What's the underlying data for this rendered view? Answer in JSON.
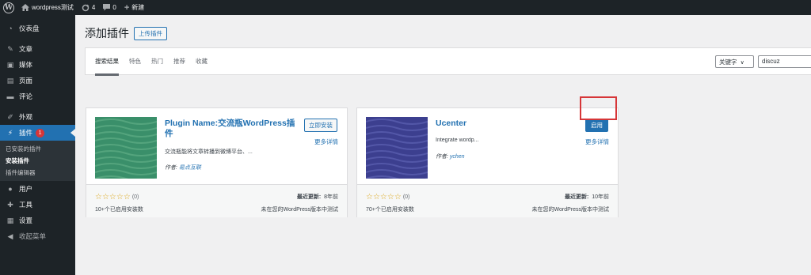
{
  "adminbar": {
    "site_name": "wordpress测试",
    "updates_count": "4",
    "comments_count": "0",
    "new_label": "新建"
  },
  "sidebar": {
    "items": [
      {
        "label": "仪表盘",
        "icon": "dashboard-icon"
      },
      {
        "label": "文章",
        "icon": "pin-icon"
      },
      {
        "label": "媒体",
        "icon": "media-icon"
      },
      {
        "label": "页面",
        "icon": "page-icon"
      },
      {
        "label": "评论",
        "icon": "comment-icon"
      },
      {
        "label": "外观",
        "icon": "brush-icon"
      },
      {
        "label": "插件",
        "icon": "plugin-icon",
        "badge": "1"
      },
      {
        "label": "用户",
        "icon": "user-icon"
      },
      {
        "label": "工具",
        "icon": "wrench-icon"
      },
      {
        "label": "设置",
        "icon": "settings-icon"
      },
      {
        "label": "收起菜单",
        "icon": "collapse-icon"
      }
    ],
    "submenu": [
      "已安装的插件",
      "安装插件",
      "插件编辑器"
    ]
  },
  "page": {
    "title": "添加插件",
    "upload_label": "上传插件"
  },
  "filter": {
    "tabs": [
      "搜索结果",
      "特色",
      "热门",
      "推荐",
      "收藏"
    ],
    "search_type": "关键字",
    "search_value": "discuz"
  },
  "plugins": [
    {
      "name": "Plugin Name:交流瓶WordPress插件",
      "description": "交流瓶能将文章转播到微博平台、...",
      "author_prefix": "作者: ",
      "author": "易点互联",
      "action_label": "立即安装",
      "more_label": "更多详情",
      "stars": "☆☆☆☆☆",
      "rating_count": "(0)",
      "installs": "10+个已启用安装数",
      "updated_label": "最近更新:",
      "updated_value": "8年前",
      "compat": "未在您的WordPress版本中测试",
      "thumb_color": "#3a8f6a"
    },
    {
      "name": "Ucenter",
      "description": "Integrate wordp...",
      "author_prefix": "作者: ",
      "author": "ychen",
      "action_label": "启用",
      "more_label": "更多详情",
      "stars": "☆☆☆☆☆",
      "rating_count": "(0)",
      "installs": "70+个已启用安装数",
      "updated_label": "最近更新:",
      "updated_value": "10年前",
      "compat": "未在您的WordPress版本中测试",
      "thumb_color": "#3c3f8f"
    }
  ],
  "colors": {
    "accent": "#2271b1",
    "sidebar_bg": "#1d2327",
    "highlight": "#d63638"
  }
}
